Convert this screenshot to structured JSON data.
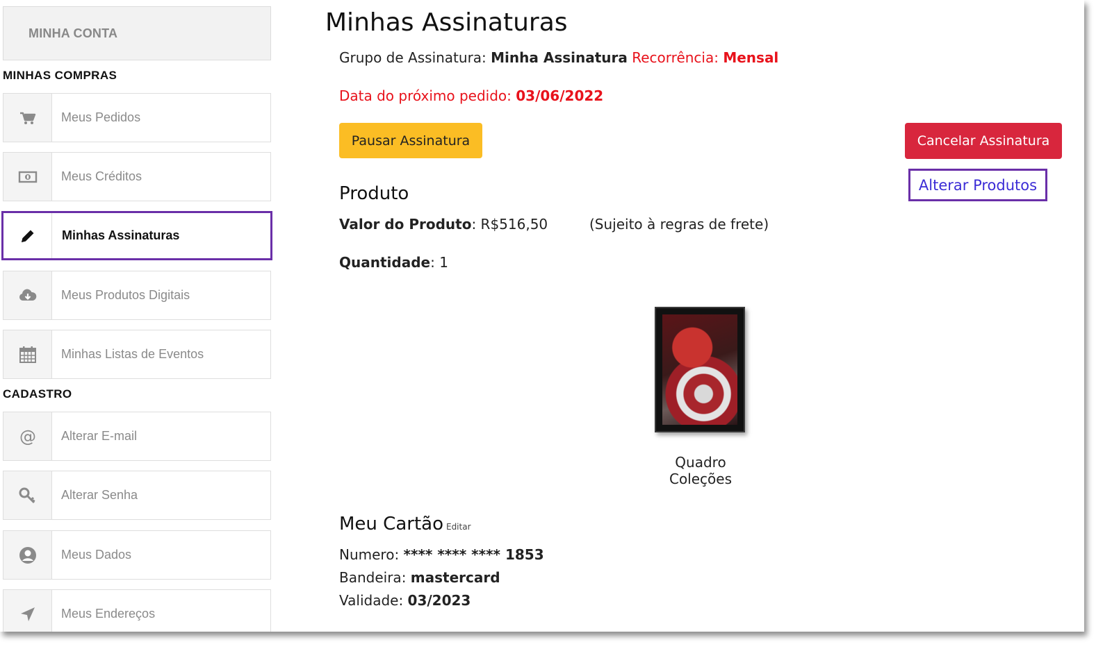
{
  "sidebar": {
    "account_label": "MINHA CONTA",
    "section_purchases": "MINHAS COMPRAS",
    "section_register": "CADASTRO",
    "items": [
      {
        "label": "Meus Pedidos",
        "icon": "cart-icon"
      },
      {
        "label": "Meus Créditos",
        "icon": "money-icon"
      },
      {
        "label": "Minhas Assinaturas",
        "icon": "pencil-icon",
        "active": true
      },
      {
        "label": "Meus Produtos Digitais",
        "icon": "cloud-download-icon"
      },
      {
        "label": "Minhas Listas de Eventos",
        "icon": "calendar-icon"
      },
      {
        "label": "Alterar E-mail",
        "icon": "at-icon"
      },
      {
        "label": "Alterar Senha",
        "icon": "key-icon"
      },
      {
        "label": "Meus Dados",
        "icon": "user-icon"
      },
      {
        "label": "Meus Endereços",
        "icon": "location-arrow-icon"
      }
    ]
  },
  "main": {
    "title": "Minhas Assinaturas",
    "group_label": "Grupo de Assinatura:",
    "group_value": "Minha Assinatura",
    "recurrence_label": "Recorrência:",
    "recurrence_value": "Mensal",
    "next_order_label": "Data do próximo pedido:",
    "next_order_value": "03/06/2022",
    "pause_button": "Pausar Assinatura",
    "cancel_button": "Cancelar Assinatura",
    "change_products_button": "Alterar Produtos",
    "product_heading": "Produto",
    "product_value_label": "Valor do Produto",
    "product_value": ": R$516,50",
    "shipping_note": "(Sujeito à regras de frete)",
    "quantity_label": "Quantidade",
    "quantity_value": ": 1",
    "product_name": "Quadro Coleções",
    "card_heading": "Meu Cartão",
    "card_edit": "Editar",
    "card_number_label": "Numero: ",
    "card_number_value": "**** **** **** 1853",
    "card_brand_label": "Bandeira: ",
    "card_brand_value": "mastercard",
    "card_validity_label": "Validade: ",
    "card_validity_value": "03/2023"
  },
  "colors": {
    "accent_purple": "#6a2fa8",
    "warning_yellow": "#fbbd24",
    "danger_red": "#d8263d",
    "text_red": "#e8121b",
    "link_blue": "#3b2cd6"
  }
}
